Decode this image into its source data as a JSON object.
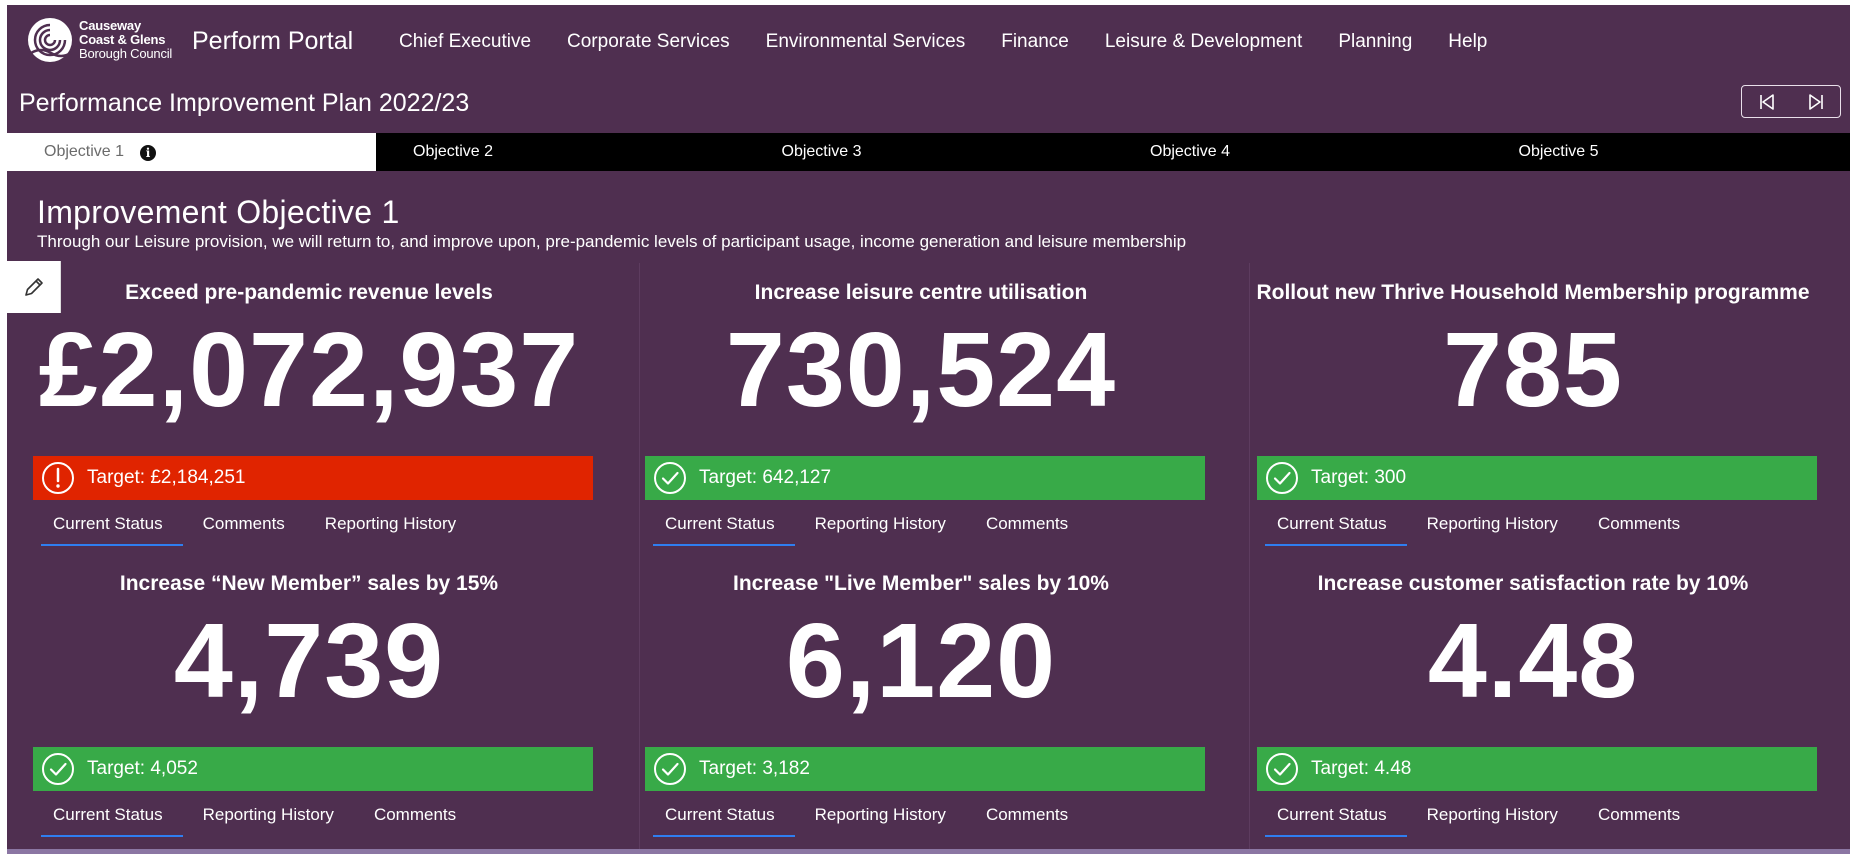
{
  "header": {
    "logo_lines": [
      "Causeway",
      "Coast & Glens",
      "Borough Council"
    ],
    "portal_title": "Perform Portal",
    "nav": [
      "Chief Executive",
      "Corporate Services",
      "Environmental Services",
      "Finance",
      "Leisure & Development",
      "Planning",
      "Help"
    ],
    "plan_title": "Performance Improvement Plan 2022/23"
  },
  "tabs": [
    "Objective 1",
    "Objective 2",
    "Objective 3",
    "Objective 4",
    "Objective 5"
  ],
  "objective": {
    "title": "Improvement Objective 1",
    "description": "Through our Leisure provision, we will return to, and improve upon, pre-pandemic levels of participant usage, income generation and leisure membership"
  },
  "colors": {
    "background": "#4f2f50",
    "red": "#e02400",
    "green": "#38aa48",
    "tab_underline": "#2f7ef0"
  },
  "cards": [
    {
      "title": "Exceed pre-pandemic revenue levels",
      "value": "£2,072,937",
      "target": "Target: £2,184,251",
      "status": "red",
      "icon": "exclamation-circle-icon",
      "tabs": [
        "Current Status",
        "Comments",
        "Reporting History"
      ]
    },
    {
      "title": "Increase leisure centre utilisation",
      "value": "730,524",
      "target": "Target: 642,127",
      "status": "green",
      "icon": "check-circle-icon",
      "tabs": [
        "Current Status",
        "Reporting History",
        "Comments"
      ]
    },
    {
      "title": "Rollout new Thrive Household Membership programme",
      "value": "785",
      "target": "Target: 300",
      "status": "green",
      "icon": "check-circle-icon",
      "tabs": [
        "Current Status",
        "Reporting History",
        "Comments"
      ]
    },
    {
      "title": "Increase “New Member” sales by 15%",
      "value": "4,739",
      "target": "Target: 4,052",
      "status": "green",
      "icon": "check-circle-icon",
      "tabs": [
        "Current Status",
        "Reporting History",
        "Comments"
      ]
    },
    {
      "title": "Increase \"Live Member\" sales by 10%",
      "value": "6,120",
      "target": "Target: 3,182",
      "status": "green",
      "icon": "check-circle-icon",
      "tabs": [
        "Current Status",
        "Reporting History",
        "Comments"
      ]
    },
    {
      "title": "Increase customer satisfaction rate by 10%",
      "value": "4.48",
      "target": "Target: 4.48",
      "status": "green",
      "icon": "check-circle-icon",
      "tabs": [
        "Current Status",
        "Reporting History",
        "Comments"
      ]
    }
  ]
}
